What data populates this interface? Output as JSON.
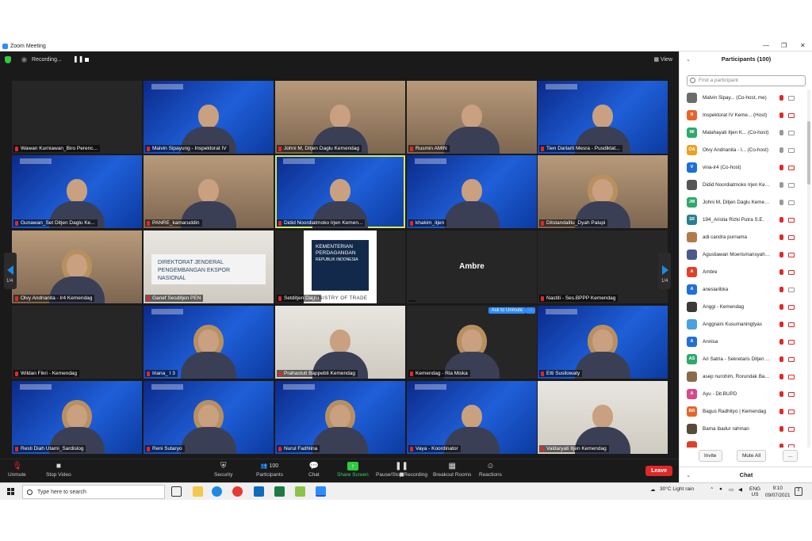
{
  "window": {
    "title": "Zoom Meeting"
  },
  "topbar": {
    "recording_label": "Recording...",
    "pause": "❚❚",
    "view_label": "View"
  },
  "grid": {
    "page_left": "1/4",
    "page_right": "1/4",
    "tiles": [
      {
        "name": "Wawan Kurniawan_Biro Perenc...",
        "style": "grey",
        "person": false
      },
      {
        "name": "Malvin Sipayung - Inspektorat IV",
        "style": "blue",
        "person": true
      },
      {
        "name": "Johni M, Ditjen Daglu Kemendag",
        "style": "room",
        "person": true
      },
      {
        "name": "Rusmin AMIN",
        "style": "room",
        "person": true
      },
      {
        "name": "Tien Darlarti Mesra - Pusdiklat...",
        "style": "blue",
        "person": true
      },
      {
        "name": "Gunawan_Set Ditjen Daglu Ke...",
        "style": "blue",
        "person": true
      },
      {
        "name": "PANRE_kamaruddin",
        "style": "room",
        "person": true
      },
      {
        "name": "Didid Noordiatmoko Irjen Kemen...",
        "style": "blue",
        "person": true,
        "active": true
      },
      {
        "name": "khakim_itjen",
        "style": "blue",
        "person": true
      },
      {
        "name": "Ditstandalitu_Dyah Palupi",
        "style": "room",
        "person": true,
        "hijab": true
      },
      {
        "name": "Olvy Andrianita - Ir4 Kemendag",
        "style": "room",
        "person": true,
        "hijab": true
      },
      {
        "name": "Ganef Sesditjen PEN",
        "style": "light",
        "plate": "DIREKTORAT JENDERAL PENGEMBANGAN EKSPOR NASIONAL"
      },
      {
        "name": "Setditjen Daglu",
        "style": "grey",
        "logo": true
      },
      {
        "name": "",
        "style": "grey",
        "bigname": "Ambre"
      },
      {
        "name": "Nastiti - Ses.BPPP Kemendag",
        "style": "grey",
        "person": false
      },
      {
        "name": "Wildan Fikri - Kemendag",
        "style": "grey",
        "person": false
      },
      {
        "name": "Iriana_ I 3",
        "style": "blue",
        "person": true,
        "hijab": true
      },
      {
        "name": "Prahastuti Bappebti Kemendag",
        "style": "light",
        "person": true
      },
      {
        "name": "Kemendag - Ria Miska",
        "style": "grey",
        "person": true,
        "hijab": true,
        "unmute": true
      },
      {
        "name": "Etti Susilowaty",
        "style": "blue",
        "person": true,
        "hijab": true
      },
      {
        "name": "Resti Diah Utami_Sardislog",
        "style": "blue",
        "person": true,
        "hijab": true
      },
      {
        "name": "Reni Sutaryo",
        "style": "blue",
        "person": true,
        "hijab": true
      },
      {
        "name": "Nurul Fadhlina",
        "style": "blue",
        "person": true,
        "hijab": true
      },
      {
        "name": "Vaya - Koordinator",
        "style": "blue",
        "person": true
      },
      {
        "name": "Valdaryati Itjen Kemendag",
        "style": "light",
        "person": true
      }
    ],
    "logo": {
      "line1": "KEMENTERIAN",
      "line2": "PERDAGANGAN",
      "line3": "REPUBLIK INDONESIA",
      "bottom": "MINISTRY OF TRADE"
    },
    "unmute_pill": "Ask to Unmute",
    "more_pill": "···"
  },
  "toolbar": {
    "unmute": "Unmute",
    "stop_video": "Stop Video",
    "security": "Security",
    "participants": "Participants",
    "participants_count": "100",
    "chat": "Chat",
    "share_screen": "Share Screen",
    "pause_recording": "Pause/Stop Recording",
    "breakout": "Breakout Rooms",
    "reactions": "Reactions",
    "leave": "Leave"
  },
  "panel": {
    "title": "Participants (100)",
    "search_placeholder": "Find a participant",
    "participants": [
      {
        "initials": "",
        "color": "#6b6b6b",
        "name": "Malvin Sipay...  (Co-host, me)",
        "muted": true,
        "cam_off": false
      },
      {
        "initials": "II",
        "color": "#e8632c",
        "name": "Inspektorat IV Keme...  (Host)",
        "muted": true,
        "cam_off": true
      },
      {
        "initials": "MI",
        "color": "#2ea96b",
        "name": "Malahayati Itjen K...  (Co-host)",
        "muted": false,
        "cam_off": false
      },
      {
        "initials": "OA",
        "color": "#f0a020",
        "name": "Olvy Andrianita - I...  (Co-host)",
        "muted": false,
        "cam_off": false
      },
      {
        "initials": "V",
        "color": "#1f6fd6",
        "name": "vina-ir4 (Co-host)",
        "muted": true,
        "cam_off": true
      },
      {
        "initials": "",
        "color": "#555555",
        "name": "Didid Noordiatmoko Irjen Kem...",
        "muted": false,
        "cam_off": false
      },
      {
        "initials": "JM",
        "color": "#2ea96b",
        "name": "Johni M, Ditjen Daglu Kemendag",
        "muted": false,
        "cam_off": false
      },
      {
        "initials": "1R",
        "color": "#2a7f8f",
        "name": "194_Aristia Rizki Putra S.E.",
        "muted": true,
        "cam_off": true
      },
      {
        "initials": "",
        "color": "#b07a4a",
        "name": "adi candra purnama",
        "muted": true,
        "cam_off": true
      },
      {
        "initials": "",
        "color": "#4a5a8a",
        "name": "Agustiawan Moerismansyah Dit...",
        "muted": true,
        "cam_off": true
      },
      {
        "initials": "A",
        "color": "#e0402a",
        "name": "Ambre",
        "muted": true,
        "cam_off": true
      },
      {
        "initials": "A",
        "color": "#1f6fd6",
        "name": "anesiaribka",
        "muted": true,
        "cam_off": false
      },
      {
        "initials": "",
        "color": "#3a3a3a",
        "name": "Anggi - Kemendag",
        "muted": true,
        "cam_off": true
      },
      {
        "initials": "",
        "color": "#4aa0e0",
        "name": "Anggraini Kusumaningtyas",
        "muted": true,
        "cam_off": true
      },
      {
        "initials": "A",
        "color": "#1f6fd6",
        "name": "Annisa",
        "muted": true,
        "cam_off": true
      },
      {
        "initials": "AS",
        "color": "#2ea96b",
        "name": "Ari Satria - Sekretaris Ditjen PPI",
        "muted": true,
        "cam_off": true
      },
      {
        "initials": "",
        "color": "#8a6a4a",
        "name": "asep nurohim, Rorundak Bappe...",
        "muted": true,
        "cam_off": true
      },
      {
        "initials": "A",
        "color": "#d84a8a",
        "name": "Ayu - Dit.BUPD",
        "muted": true,
        "cam_off": true
      },
      {
        "initials": "BR",
        "color": "#e8632c",
        "name": "Bagus Radhityo | Kemendag",
        "muted": true,
        "cam_off": true
      },
      {
        "initials": "",
        "color": "#5a4a3a",
        "name": "Bama ibadur rahman",
        "muted": true,
        "cam_off": true
      },
      {
        "initials": "",
        "color": "#e0402a",
        "name": "",
        "muted": true,
        "cam_off": true
      }
    ],
    "invite": "Invite",
    "mute_all": "Mute All",
    "more": "...",
    "chat_title": "Chat"
  },
  "taskbar": {
    "search_placeholder": "Type here to search",
    "weather": "30°C  Light rain",
    "lang_top": "ENG",
    "lang_bottom": "US",
    "time": "9:10",
    "date": "09/07/2021",
    "notif_count": "2"
  }
}
